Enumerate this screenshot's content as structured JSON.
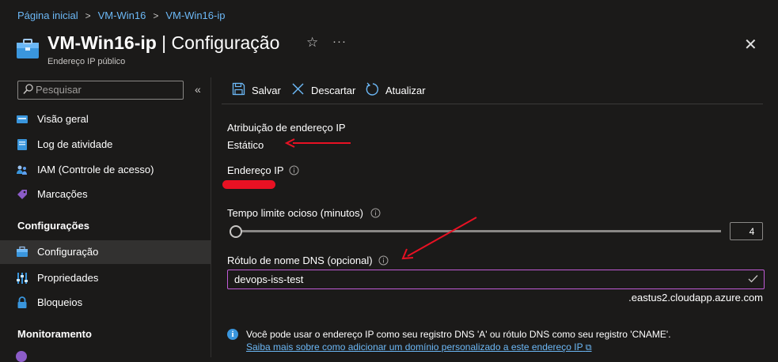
{
  "breadcrumb": {
    "items": [
      "Página inicial",
      "VM-Win16",
      "VM-Win16-ip"
    ]
  },
  "header": {
    "title_main": "VM-Win16-ip",
    "title_rest": " | Configuração",
    "subtitle": "Endereço IP público",
    "favorite_icon": "star-icon",
    "more_icon": "ellipsis-icon",
    "close_icon": "close-icon"
  },
  "sidebar": {
    "search_placeholder": "Pesquisar",
    "collapse_glyph": "«",
    "items_top": [
      {
        "label": "Visão geral",
        "icon": "overview-icon"
      },
      {
        "label": "Log de atividade",
        "icon": "activity-log-icon"
      },
      {
        "label": "IAM (Controle de acesso)",
        "icon": "iam-icon"
      },
      {
        "label": "Marcações",
        "icon": "tag-icon"
      }
    ],
    "group_settings": "Configurações",
    "items_settings": [
      {
        "label": "Configuração",
        "icon": "configuration-icon",
        "active": true
      },
      {
        "label": "Propriedades",
        "icon": "properties-icon"
      },
      {
        "label": "Bloqueios",
        "icon": "lock-icon"
      }
    ],
    "group_monitoring": "Monitoramento"
  },
  "toolbar": {
    "save_label": "Salvar",
    "discard_label": "Descartar",
    "refresh_label": "Atualizar"
  },
  "form": {
    "assignment_label": "Atribuição de endereço IP",
    "assignment_value": "Estático",
    "ip_address_label": "Endereço IP",
    "idle_timeout_label": "Tempo limite ocioso (minutos)",
    "idle_timeout_value": "4",
    "dns_label": "Rótulo de nome DNS (opcional)",
    "dns_value": "devops-iss-test",
    "dns_suffix": ".eastus2.cloudapp.azure.com"
  },
  "info": {
    "text": "Você pode usar o endereço IP como seu registro DNS 'A' ou rótulo DNS como seu registro 'CNAME'.",
    "link": "Saiba mais sobre como adicionar um domínio personalizado a este endereço IP"
  },
  "colors": {
    "accent": "#6cb8f6",
    "annotation_red": "#e81123",
    "dns_border": "#c05bd6"
  }
}
